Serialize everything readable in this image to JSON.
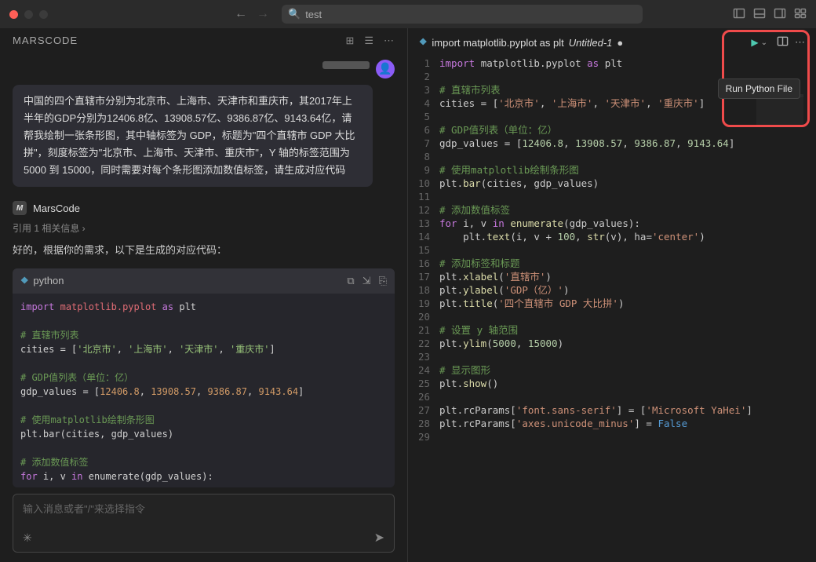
{
  "titlebar": {
    "search_value": "test"
  },
  "panel": {
    "title": "MARSCODE"
  },
  "user_message": "中国的四个直辖市分别为北京市、上海市、天津市和重庆市，其2017年上半年的GDP分别为12406.8亿、13908.57亿、9386.87亿、9143.64亿，请帮我绘制一张条形图，其中轴标签为 GDP，标题为\"四个直辖市 GDP 大比拼\"，刻度标签为\"北京市、上海市、天津市、重庆市\"，Y 轴的标签范围为 5000 到 15000，同时需要对每个条形图添加数值标签，请生成对应代码",
  "assistant": {
    "name": "MarsCode",
    "ref_link": "引用 1 相关信息 ›",
    "intro": "好的，根据你的需求，以下是生成的对应代码：",
    "code_lang": "python"
  },
  "chat": {
    "placeholder": "输入消息或者\"/\"来选择指令"
  },
  "tab": {
    "title": "import matplotlib.pyplot as plt",
    "file": "Untitled-1"
  },
  "tooltip": "Run Python File",
  "chart_data": {
    "type": "bar",
    "categories": [
      "北京市",
      "上海市",
      "天津市",
      "重庆市"
    ],
    "values": [
      12406.8,
      13908.57,
      9386.87,
      9143.64
    ],
    "title": "四个直辖市 GDP 大比拼",
    "xlabel": "直辖市",
    "ylabel": "GDP（亿）",
    "ylim": [
      5000,
      15000
    ]
  },
  "chat_code": {
    "l1a": "import",
    "l1b": "matplotlib.pyplot",
    "l1c": "as",
    "l1d": "plt",
    "c1": "# 直辖市列表",
    "l2a": "cities = [",
    "l2b": "'北京市'",
    "l2c": ", ",
    "l2d": "'上海市'",
    "l2e": ", ",
    "l2f": "'天津市'",
    "l2g": ", ",
    "l2h": "'重庆市'",
    "l2i": "]",
    "c2": "# GDP值列表（单位：亿）",
    "l3a": "gdp_values = [",
    "l3b": "12406.8",
    "l3c": ", ",
    "l3d": "13908.57",
    "l3e": ", ",
    "l3f": "9386.87",
    "l3g": ", ",
    "l3h": "9143.64",
    "l3i": "]",
    "c3": "# 使用matplotlib绘制条形图",
    "l4": "plt.bar(cities, gdp_values)",
    "c4": "# 添加数值标签",
    "l5a": "for",
    "l5b": " i, v ",
    "l5c": "in",
    "l5d": " enumerate(gdp_values):"
  },
  "editor": {
    "lines": [
      "1",
      "2",
      "3",
      "4",
      "5",
      "6",
      "7",
      "8",
      "9",
      "10",
      "11",
      "12",
      "13",
      "14",
      "15",
      "16",
      "17",
      "18",
      "19",
      "20",
      "21",
      "22",
      "23",
      "24",
      "25",
      "26",
      "27",
      "28",
      "29"
    ],
    "l1_kw": "import",
    "l1_mod": "matplotlib.pyplot",
    "l1_as": "as",
    "l1_id": "plt",
    "l3_c": "# 直辖市列表",
    "l4_a": "cities = [",
    "l4_s1": "'北京市'",
    "l4_c": ", ",
    "l4_s2": "'上海市'",
    "l4_s3": "'天津市'",
    "l4_s4": "'重庆市'",
    "l4_z": "]",
    "l6_c": "# GDP值列表（单位：亿）",
    "l7_a": "gdp_values = [",
    "l7_n1": "12406.8",
    "l7_n2": "13908.57",
    "l7_n3": "9386.87",
    "l7_n4": "9143.64",
    "l7_z": "]",
    "l9_c": "# 使用matplotlib绘制条形图",
    "l10_a": "plt.",
    "l10_fn": "bar",
    "l10_b": "(cities, gdp_values)",
    "l12_c": "# 添加数值标签",
    "l13_kw": "for",
    "l13_a": " i, v ",
    "l13_in": "in",
    "l13_b": " ",
    "l13_fn": "enumerate",
    "l13_c": "(gdp_values):",
    "l14_a": "    plt.",
    "l14_fn": "text",
    "l14_b": "(i, v + ",
    "l14_n": "100",
    "l14_c": ", ",
    "l14_fn2": "str",
    "l14_d": "(v), ha=",
    "l14_s": "'center'",
    "l14_e": ")",
    "l16_c": "# 添加标签和标题",
    "l17_a": "plt.",
    "l17_fn": "xlabel",
    "l17_b": "(",
    "l17_s": "'直辖市'",
    "l17_c": ")",
    "l18_a": "plt.",
    "l18_fn": "ylabel",
    "l18_b": "(",
    "l18_s": "'GDP（亿）'",
    "l18_c": ")",
    "l19_a": "plt.",
    "l19_fn": "title",
    "l19_b": "(",
    "l19_s": "'四个直辖市 GDP 大比拼'",
    "l19_c": ")",
    "l21_c": "# 设置 y 轴范围",
    "l22_a": "plt.",
    "l22_fn": "ylim",
    "l22_b": "(",
    "l22_n1": "5000",
    "l22_c": ", ",
    "l22_n2": "15000",
    "l22_d": ")",
    "l24_c": "# 显示图形",
    "l25_a": "plt.",
    "l25_fn": "show",
    "l25_b": "()",
    "l27_a": "plt.rcParams[",
    "l27_s": "'font.sans-serif'",
    "l27_b": "] = [",
    "l27_s2": "'Microsoft YaHei'",
    "l27_c": "]",
    "l28_a": "plt.rcParams[",
    "l28_s": "'axes.unicode_minus'",
    "l28_b": "] = ",
    "l28_v": "False"
  }
}
